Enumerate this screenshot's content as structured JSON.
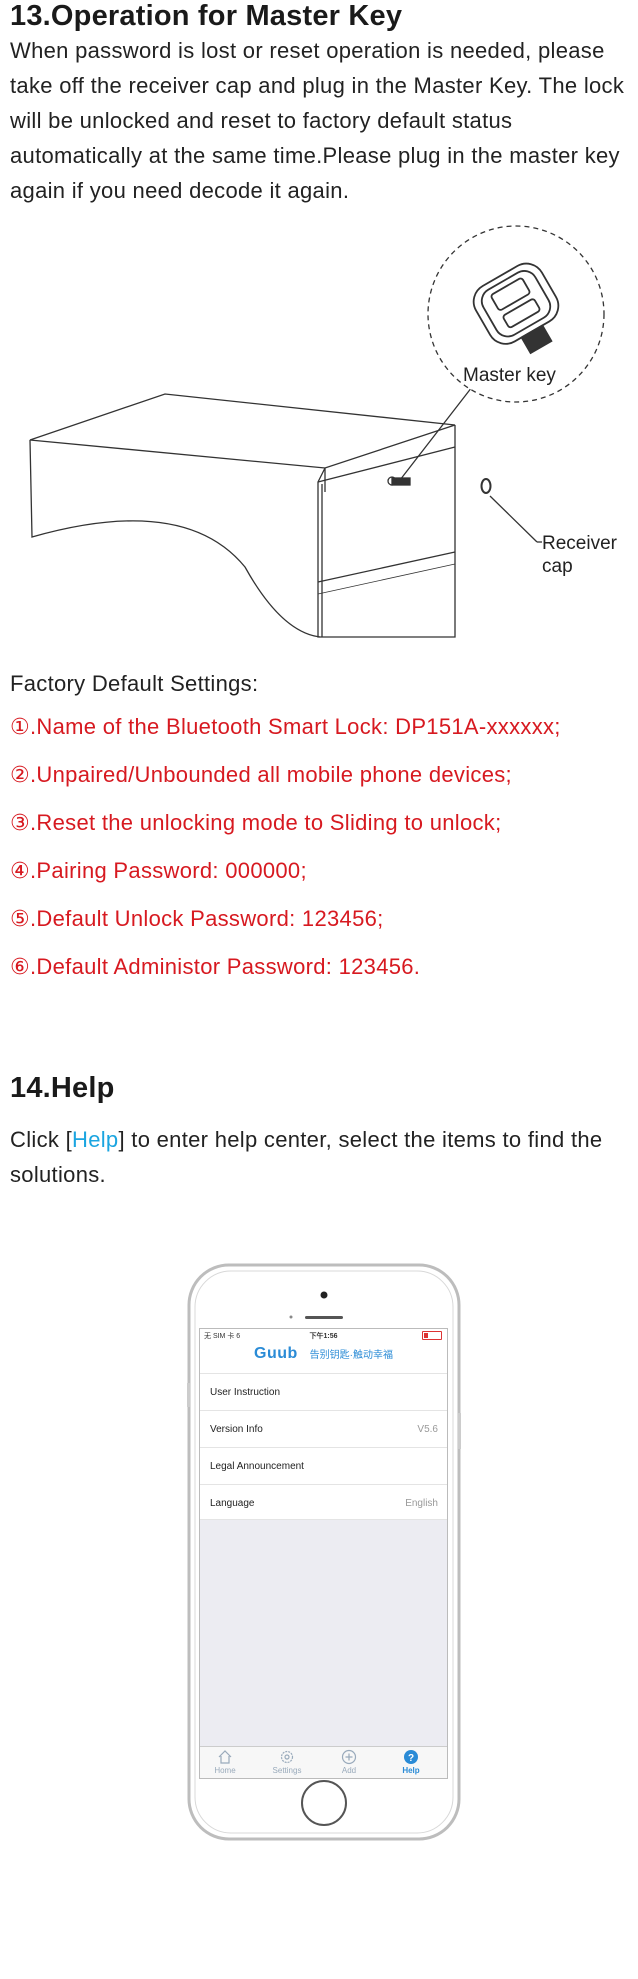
{
  "section13": {
    "title": "13.Operation for Master Key",
    "body": "When password is lost or reset operation is needed, please take off the receiver cap and plug in the Master Key. The lock will be unlocked and reset to factory default status automatically at  the same time.Please plug in the master key again if you need decode it again.",
    "figure": {
      "master_key_label": "Master key",
      "receiver_label_line1": "Receiver",
      "receiver_label_line2": "cap"
    },
    "factory_heading": "Factory Default Settings:",
    "defaults": [
      "①.Name of the Bluetooth Smart Lock: DP151A-xxxxxx;",
      "②.Unpaired/Unbounded all mobile phone devices;",
      "③.Reset the unlocking mode to Sliding to unlock;",
      "④.Pairing Password: 000000;",
      "⑤.Default Unlock Password: 123456;",
      "⑥.Default Administor Password: 123456."
    ]
  },
  "section14": {
    "title": "14.Help",
    "body_prefix": "Click [",
    "body_link": "Help",
    "body_suffix": "] to enter help center, select the items to find the solutions."
  },
  "phone": {
    "status": {
      "carrier": "无 SIM 卡 ὏6",
      "time": "下午1:56"
    },
    "brand": {
      "logo": "Guub",
      "slogan": "告别钥匙·触动幸福"
    },
    "menu": [
      {
        "label": "User Instruction",
        "value": ""
      },
      {
        "label": "Version Info",
        "value": "V5.6"
      },
      {
        "label": "Legal Announcement",
        "value": ""
      },
      {
        "label": "Language",
        "value": "English"
      }
    ],
    "tabs": [
      {
        "label": "Home",
        "icon": "home-icon"
      },
      {
        "label": "Settings",
        "icon": "gear-icon"
      },
      {
        "label": "Add",
        "icon": "plus-circle-icon"
      },
      {
        "label": "Help",
        "icon": "question-icon"
      }
    ],
    "colors": {
      "brand": "#2a8bd6",
      "alert_red": "#d71920",
      "link": "#1ba5e0"
    }
  }
}
